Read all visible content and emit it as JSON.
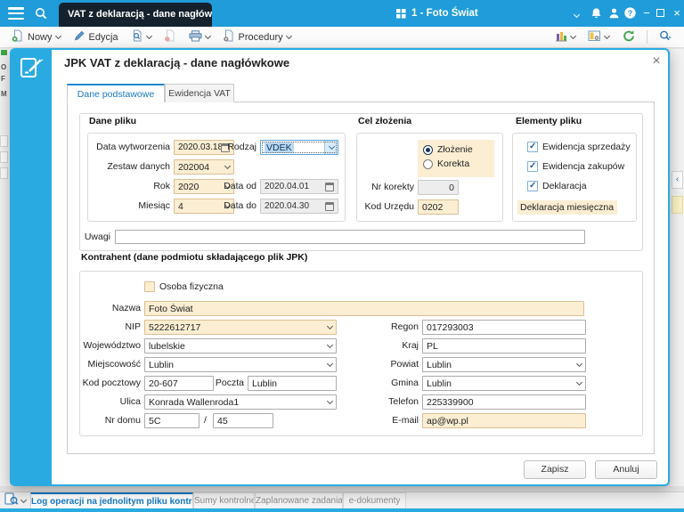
{
  "titlebar": {
    "tab_title": "VAT z deklaracją - dane nagłówkow",
    "workspace": "1 - Foto Świat",
    "minimize": "−",
    "close": "×"
  },
  "toolbar": {
    "new_label": "Nowy",
    "edit_label": "Edycja",
    "procedures_label": "Procedury"
  },
  "dialog": {
    "title": "JPK VAT z deklaracją - dane nagłówkowe",
    "close": "×",
    "tabs": [
      {
        "label": "Dane podstawowe"
      },
      {
        "label": "Ewidencja VAT"
      }
    ],
    "dane_pliku": {
      "title": "Dane pliku",
      "data_wytworzenia": {
        "label": "Data wytworzenia",
        "value": "2020.03.18"
      },
      "zestaw_danych": {
        "label": "Zestaw danych",
        "value": "202004"
      },
      "rok": {
        "label": "Rok",
        "value": "2020"
      },
      "miesiac": {
        "label": "Miesiąc",
        "value": "4"
      },
      "rodzaj": {
        "label": "Rodzaj",
        "value": "VDEK"
      },
      "data_od": {
        "label": "Data od",
        "value": "2020.04.01"
      },
      "data_do": {
        "label": "Data do",
        "value": "2020.04.30"
      }
    },
    "cel_zlozenia": {
      "title": "Cel złożenia",
      "zlozenie": "Złożenie",
      "korekta": "Korekta",
      "nr_korekty": {
        "label": "Nr korekty",
        "value": "0"
      },
      "kod_urzedu": {
        "label": "Kod Urzędu",
        "value": "0202"
      }
    },
    "elementy_pliku": {
      "title": "Elementy pliku",
      "items": [
        {
          "label": "Ewidencja sprzedaży",
          "checked": true
        },
        {
          "label": "Ewidencja zakupów",
          "checked": true
        },
        {
          "label": "Deklaracja",
          "checked": true
        }
      ],
      "note": "Deklaracja miesięczna"
    },
    "uwagi": {
      "label": "Uwagi",
      "value": ""
    },
    "kontrahent": {
      "title": "Kontrahent (dane podmiotu składającego plik JPK)",
      "osoba_fizyczna": "Osoba fizyczna",
      "nazwa": {
        "label": "Nazwa",
        "value": "Foto Świat"
      },
      "nip": {
        "label": "NIP",
        "value": "5222612717"
      },
      "wojewodztwo": {
        "label": "Województwo",
        "value": "lubelskie"
      },
      "miejscowosc": {
        "label": "Miejscowość",
        "value": "Lublin"
      },
      "kod_pocztowy": {
        "label": "Kod pocztowy",
        "value": "20-607"
      },
      "poczta": {
        "label": "Poczta",
        "value": "Lublin"
      },
      "ulica": {
        "label": "Ulica",
        "value": "Konrada Wallenroda1"
      },
      "nr_domu": {
        "label": "Nr domu",
        "value": "5C",
        "separator": "/",
        "value2": "45"
      },
      "regon": {
        "label": "Regon",
        "value": "017293003"
      },
      "kraj": {
        "label": "Kraj",
        "value": "PL"
      },
      "powiat": {
        "label": "Powiat",
        "value": "Lublin"
      },
      "gmina": {
        "label": "Gmina",
        "value": "Lublin"
      },
      "telefon": {
        "label": "Telefon",
        "value": "225339900"
      },
      "email": {
        "label": "E-mail",
        "value": "ap@wp.pl"
      }
    },
    "save_label": "Zapisz",
    "cancel_label": "Anuluj"
  },
  "bottombar": {
    "tabs": [
      {
        "label": "Log operacji na jednolitym pliku kontrolnym",
        "active": true
      },
      {
        "label": "Sumy kontrolne",
        "active": false
      },
      {
        "label": "Zaplanowane zadania",
        "active": false
      },
      {
        "label": "e-dokumenty",
        "active": false
      }
    ]
  },
  "colors": {
    "titlebar": "#1F9CD9",
    "accent": "#29ABE2",
    "required_field_bg": "#FBEED3",
    "required_field_border": "#DCBE93",
    "active_tab_text": "#1779C4",
    "refresh_green": "#3DA648"
  }
}
